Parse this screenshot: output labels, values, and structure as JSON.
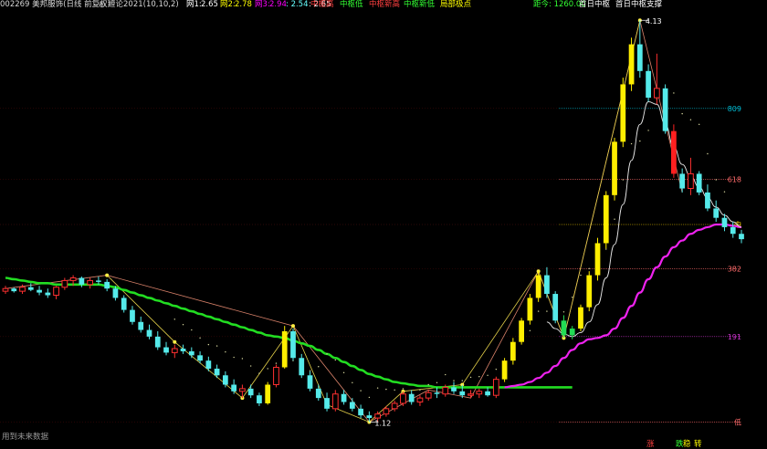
{
  "header": {
    "code_name": "002269 美邦服饰(日线 前复权)",
    "indicator": "缠论2021(10,10,2)",
    "w1_label": "网1:",
    "w1_value": "2.65",
    "w2_label": "网2:",
    "w2_value": "2.78",
    "w3_label": "网3:",
    "w3_value": "2.94",
    "w3_extra": ": 2.54",
    "w3_extra2": ": 2.65",
    "legend": [
      "中枢高",
      "中枢低",
      "中枢新高",
      "中枢新低",
      "局部极点"
    ],
    "distance": "距今: 1260.00",
    "right_label_1": "首日中枢",
    "right_label_2": "首日中枢支撑",
    "colors": {
      "code": "#d8d8d8",
      "w1": "#ffffff",
      "w2": "#ffff00",
      "w3": "#ff00ff",
      "legend": [
        "#ff4040",
        "#33ff33",
        "#ff4040",
        "#33ff33",
        "#ffff00"
      ],
      "distance": "#33ff33",
      "right": "#ffffff"
    }
  },
  "footer_text": "用到未来数据",
  "bottom_marks": [
    "涨",
    "跌",
    "稳",
    "转"
  ],
  "chart_data": {
    "type": "candlestick",
    "ylim": [
      1.0,
      4.2
    ],
    "price_levels": [
      {
        "label": "809",
        "value": 3.47,
        "color": "#00bcd4"
      },
      {
        "label": "618",
        "value": 2.94,
        "color": "#ff6b6b"
      },
      {
        "label": "中",
        "value": 2.6,
        "color": "#ffd700"
      },
      {
        "label": "382",
        "value": 2.27,
        "color": "#ff6b6b"
      },
      {
        "label": "191",
        "value": 1.76,
        "color": "#cc33cc"
      },
      {
        "label": "低",
        "value": 1.12,
        "color": "#ff6b6b"
      }
    ],
    "marks": [
      {
        "label": "4.13",
        "value": 4.13
      },
      {
        "label": "1.12",
        "value": 1.12
      }
    ],
    "candles": [
      [
        2.1,
        2.14,
        2.08,
        2.12
      ],
      [
        2.12,
        2.13,
        2.09,
        2.1
      ],
      [
        2.1,
        2.15,
        2.08,
        2.13
      ],
      [
        2.13,
        2.16,
        2.1,
        2.11
      ],
      [
        2.11,
        2.14,
        2.07,
        2.09
      ],
      [
        2.09,
        2.12,
        2.05,
        2.07
      ],
      [
        2.07,
        2.14,
        2.04,
        2.13
      ],
      [
        2.13,
        2.2,
        2.11,
        2.18
      ],
      [
        2.18,
        2.22,
        2.14,
        2.2
      ],
      [
        2.2,
        2.21,
        2.13,
        2.15
      ],
      [
        2.15,
        2.2,
        2.12,
        2.18
      ],
      [
        2.18,
        2.21,
        2.15,
        2.17
      ],
      [
        2.17,
        2.19,
        2.1,
        2.12
      ],
      [
        2.12,
        2.14,
        2.03,
        2.05
      ],
      [
        2.05,
        2.07,
        1.94,
        1.96
      ],
      [
        1.96,
        1.99,
        1.85,
        1.87
      ],
      [
        1.87,
        1.91,
        1.79,
        1.81
      ],
      [
        1.81,
        1.85,
        1.74,
        1.76
      ],
      [
        1.76,
        1.8,
        1.66,
        1.68
      ],
      [
        1.68,
        1.72,
        1.62,
        1.64
      ],
      [
        1.64,
        1.7,
        1.6,
        1.67
      ],
      [
        1.67,
        1.7,
        1.63,
        1.65
      ],
      [
        1.65,
        1.68,
        1.6,
        1.62
      ],
      [
        1.62,
        1.65,
        1.56,
        1.58
      ],
      [
        1.58,
        1.61,
        1.5,
        1.52
      ],
      [
        1.52,
        1.55,
        1.45,
        1.47
      ],
      [
        1.47,
        1.5,
        1.38,
        1.4
      ],
      [
        1.4,
        1.44,
        1.33,
        1.35
      ],
      [
        1.35,
        1.4,
        1.3,
        1.37
      ],
      [
        1.37,
        1.4,
        1.3,
        1.32
      ],
      [
        1.32,
        1.34,
        1.24,
        1.26
      ],
      [
        1.26,
        1.42,
        1.25,
        1.4
      ],
      [
        1.4,
        1.55,
        1.38,
        1.53
      ],
      [
        1.53,
        1.84,
        1.52,
        1.8
      ],
      [
        1.8,
        1.82,
        1.58,
        1.6
      ],
      [
        1.6,
        1.63,
        1.45,
        1.47
      ],
      [
        1.47,
        1.5,
        1.35,
        1.37
      ],
      [
        1.37,
        1.4,
        1.28,
        1.3
      ],
      [
        1.3,
        1.34,
        1.2,
        1.22
      ],
      [
        1.22,
        1.36,
        1.2,
        1.33
      ],
      [
        1.33,
        1.36,
        1.25,
        1.27
      ],
      [
        1.27,
        1.3,
        1.2,
        1.22
      ],
      [
        1.22,
        1.25,
        1.15,
        1.17
      ],
      [
        1.17,
        1.2,
        1.12,
        1.15
      ],
      [
        1.15,
        1.2,
        1.12,
        1.18
      ],
      [
        1.18,
        1.24,
        1.16,
        1.22
      ],
      [
        1.22,
        1.28,
        1.2,
        1.26
      ],
      [
        1.26,
        1.35,
        1.24,
        1.33
      ],
      [
        1.33,
        1.36,
        1.25,
        1.27
      ],
      [
        1.27,
        1.32,
        1.24,
        1.3
      ],
      [
        1.3,
        1.36,
        1.28,
        1.34
      ],
      [
        1.34,
        1.38,
        1.3,
        1.33
      ],
      [
        1.33,
        1.4,
        1.31,
        1.38
      ],
      [
        1.38,
        1.42,
        1.33,
        1.35
      ],
      [
        1.35,
        1.4,
        1.3,
        1.32
      ],
      [
        1.32,
        1.36,
        1.3,
        1.33
      ],
      [
        1.33,
        1.37,
        1.3,
        1.35
      ],
      [
        1.35,
        1.38,
        1.31,
        1.32
      ],
      [
        1.32,
        1.46,
        1.3,
        1.44
      ],
      [
        1.44,
        1.6,
        1.42,
        1.58
      ],
      [
        1.58,
        1.75,
        1.55,
        1.72
      ],
      [
        1.72,
        1.9,
        1.7,
        1.88
      ],
      [
        1.88,
        2.08,
        1.85,
        2.05
      ],
      [
        2.05,
        2.25,
        2.02,
        2.22
      ],
      [
        2.22,
        2.28,
        2.05,
        2.08
      ],
      [
        2.08,
        2.1,
        1.86,
        1.88
      ],
      [
        1.88,
        1.92,
        1.75,
        1.77
      ],
      [
        1.77,
        1.84,
        1.74,
        1.82
      ],
      [
        1.82,
        2.0,
        1.8,
        1.98
      ],
      [
        1.98,
        2.25,
        1.95,
        2.22
      ],
      [
        2.22,
        2.5,
        2.18,
        2.46
      ],
      [
        2.46,
        2.85,
        2.42,
        2.82
      ],
      [
        2.82,
        3.25,
        2.78,
        3.22
      ],
      [
        3.22,
        3.7,
        3.18,
        3.65
      ],
      [
        3.65,
        4.0,
        3.6,
        3.95
      ],
      [
        3.95,
        4.13,
        3.7,
        3.75
      ],
      [
        3.75,
        3.8,
        3.52,
        3.55
      ],
      [
        3.55,
        3.88,
        3.5,
        3.62
      ],
      [
        3.62,
        3.65,
        3.28,
        3.3
      ],
      [
        3.3,
        3.35,
        2.95,
        2.98
      ],
      [
        2.98,
        3.02,
        2.84,
        2.87
      ],
      [
        2.87,
        3.1,
        2.82,
        2.98
      ],
      [
        2.98,
        3.0,
        2.82,
        2.84
      ],
      [
        2.84,
        2.9,
        2.7,
        2.72
      ],
      [
        2.72,
        2.78,
        2.62,
        2.65
      ],
      [
        2.65,
        2.68,
        2.55,
        2.58
      ],
      [
        2.58,
        2.62,
        2.5,
        2.53
      ],
      [
        2.53,
        2.56,
        2.46,
        2.49
      ]
    ],
    "ma_green": [
      2.2,
      2.19,
      2.18,
      2.17,
      2.16,
      2.16,
      2.15,
      2.15,
      2.15,
      2.15,
      2.15,
      2.15,
      2.14,
      2.13,
      2.11,
      2.09,
      2.07,
      2.05,
      2.03,
      2.01,
      1.99,
      1.97,
      1.95,
      1.93,
      1.91,
      1.89,
      1.87,
      1.85,
      1.83,
      1.81,
      1.79,
      1.77,
      1.76,
      1.75,
      1.73,
      1.71,
      1.69,
      1.66,
      1.63,
      1.6,
      1.57,
      1.54,
      1.51,
      1.48,
      1.46,
      1.44,
      1.42,
      1.41,
      1.4,
      1.39,
      1.39,
      1.38,
      1.38,
      1.38,
      1.38,
      1.38,
      1.38,
      1.38,
      1.38,
      1.38,
      1.38,
      1.38,
      1.38,
      1.38,
      1.38,
      1.38,
      1.38,
      1.38
    ],
    "ma_magenta": [
      1.38,
      1.39,
      1.4,
      1.42,
      1.45,
      1.49,
      1.54,
      1.6,
      1.66,
      1.71,
      1.74,
      1.75,
      1.77,
      1.82,
      1.9,
      1.99,
      2.09,
      2.19,
      2.28,
      2.36,
      2.43,
      2.48,
      2.53,
      2.56,
      2.58,
      2.6,
      2.6,
      2.59,
      2.58
    ],
    "ma_white": [
      1.87,
      1.82,
      1.78,
      1.76,
      1.79,
      1.87,
      2.0,
      2.2,
      2.45,
      2.75,
      3.08,
      3.35,
      3.52,
      3.5,
      3.35,
      3.18,
      3.05,
      2.96,
      2.88,
      2.8,
      2.73,
      2.67,
      2.62,
      2.58
    ],
    "zigzag_brown": [
      [
        0,
        2.12
      ],
      [
        12,
        2.22
      ],
      [
        34,
        1.84
      ],
      [
        43,
        1.12
      ],
      [
        50,
        1.36
      ],
      [
        55,
        1.3
      ],
      [
        63,
        2.25
      ],
      [
        66,
        1.75
      ],
      [
        75,
        4.13
      ],
      [
        80,
        2.84
      ]
    ],
    "zigzag_yellow": [
      [
        12,
        2.22
      ],
      [
        20,
        1.72
      ],
      [
        28,
        1.3
      ],
      [
        34,
        1.84
      ],
      [
        38,
        1.25
      ],
      [
        43,
        1.12
      ],
      [
        47,
        1.35
      ],
      [
        54,
        1.4
      ],
      [
        63,
        2.25
      ],
      [
        66,
        1.75
      ],
      [
        75,
        4.13
      ]
    ]
  }
}
